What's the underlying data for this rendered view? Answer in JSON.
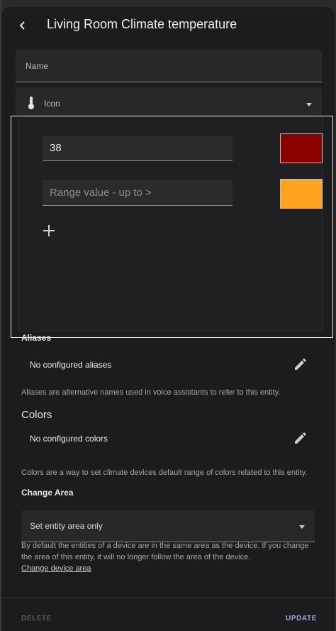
{
  "header": {
    "title": "Living Room Climate temperature"
  },
  "name_field": {
    "label": "Name"
  },
  "icon_field": {
    "label": "Icon"
  },
  "ranges": [
    {
      "value": "38",
      "placeholder": "",
      "color": "#8b0000"
    },
    {
      "value": "",
      "placeholder": "Range value - up to >",
      "color": "#ffa31f"
    }
  ],
  "aliases": {
    "title": "Aliases",
    "empty_text": "No configured aliases",
    "help": "Aliases are alternative names used in voice assistants to refer to this entity."
  },
  "colors": {
    "title": "Colors",
    "empty_text": "No configured colors",
    "help": "Colors are a way to set climate devices default range of colors related to this entity."
  },
  "area": {
    "title": "Change Area",
    "select_label": "Set entity area only",
    "help": "By default the entities of a device are in the same area as the device. If you change the area of this entity, it will no longer follow the area of the device.",
    "link": "Change device area"
  },
  "footer": {
    "delete_label": "DELETE",
    "update_label": "UPDATE"
  }
}
